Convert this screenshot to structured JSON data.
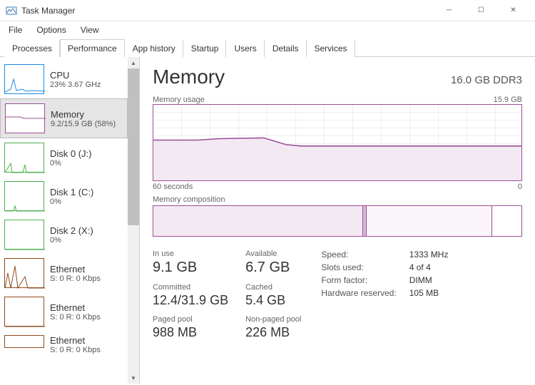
{
  "window": {
    "title": "Task Manager"
  },
  "menu": {
    "file": "File",
    "options": "Options",
    "view": "View"
  },
  "tabs": {
    "processes": "Processes",
    "performance": "Performance",
    "app_history": "App history",
    "startup": "Startup",
    "users": "Users",
    "details": "Details",
    "services": "Services"
  },
  "sidebar": [
    {
      "name": "CPU",
      "sub": "23% 3.67 GHz",
      "color": "#1e88e5"
    },
    {
      "name": "Memory",
      "sub": "9.2/15.9 GB (58%)",
      "color": "#9b4f96"
    },
    {
      "name": "Disk 0 (J:)",
      "sub": "0%",
      "color": "#4caf50"
    },
    {
      "name": "Disk 1 (C:)",
      "sub": "0%",
      "color": "#4caf50"
    },
    {
      "name": "Disk 2 (X:)",
      "sub": "0%",
      "color": "#4caf50"
    },
    {
      "name": "Ethernet",
      "sub": "S: 0 R: 0 Kbps",
      "color": "#8d4b1f"
    },
    {
      "name": "Ethernet",
      "sub": "S: 0 R: 0 Kbps",
      "color": "#8d4b1f"
    },
    {
      "name": "Ethernet",
      "sub": "S: 0 R: 0 Kbps",
      "color": "#8d4b1f"
    }
  ],
  "main": {
    "title": "Memory",
    "capacity": "16.0 GB DDR3",
    "usage_label": "Memory usage",
    "usage_max": "15.9 GB",
    "time_left": "60 seconds",
    "time_right": "0",
    "composition_label": "Memory composition",
    "stats": {
      "in_use_label": "In use",
      "in_use": "9.1 GB",
      "available_label": "Available",
      "available": "6.7 GB",
      "committed_label": "Committed",
      "committed": "12.4/31.9 GB",
      "cached_label": "Cached",
      "cached": "5.4 GB",
      "paged_label": "Paged pool",
      "paged": "988 MB",
      "nonpaged_label": "Non-paged pool",
      "nonpaged": "226 MB"
    },
    "info": {
      "speed_k": "Speed:",
      "speed_v": "1333 MHz",
      "slots_k": "Slots used:",
      "slots_v": "4 of 4",
      "form_k": "Form factor:",
      "form_v": "DIMM",
      "hw_k": "Hardware reserved:",
      "hw_v": "105 MB"
    }
  },
  "chart_data": {
    "type": "area",
    "title": "Memory usage",
    "ylabel": "GB",
    "ylim": [
      0,
      15.9
    ],
    "xlim_label": [
      "60 seconds",
      "0"
    ],
    "x": [
      0,
      5,
      10,
      15,
      20,
      25,
      30,
      35,
      40,
      45,
      50,
      55,
      60
    ],
    "values": [
      9.2,
      9.2,
      9.3,
      9.4,
      9.5,
      9.5,
      9.0,
      8.9,
      8.9,
      8.9,
      8.9,
      8.9,
      8.9
    ],
    "composition_pct": {
      "in_use": 57,
      "modified": 1,
      "standby": 34,
      "free": 8
    }
  }
}
